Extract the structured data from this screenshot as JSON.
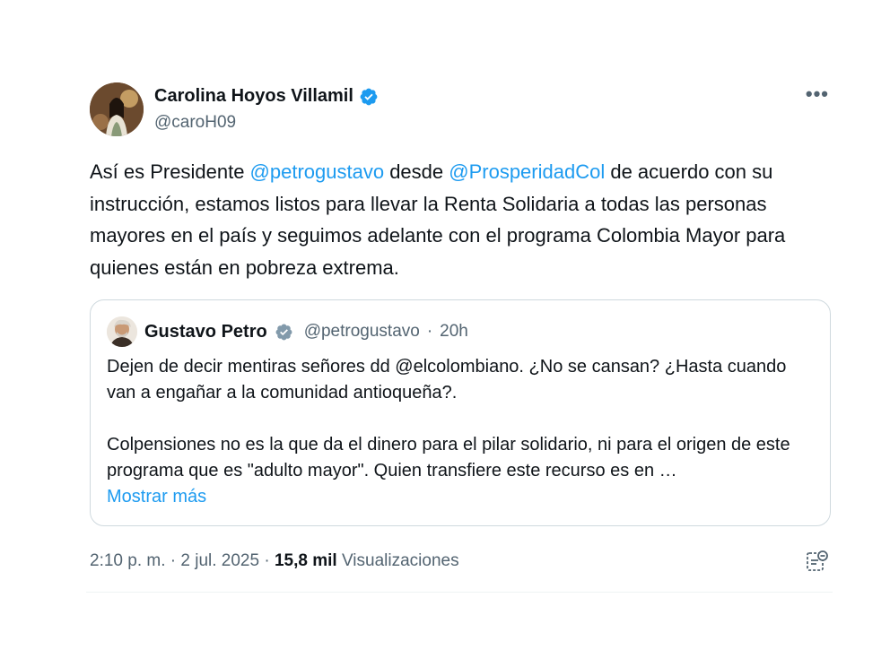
{
  "tweet": {
    "author_name": "Carolina Hoyos Villamil",
    "author_handle": "@caroH09",
    "more_label": "•••",
    "text_parts": {
      "p1": "Así  es Presidente ",
      "mention1": "@petrogustavo",
      "p2": " desde ",
      "mention2": "@ProsperidadCol",
      "p3": " de acuerdo con su instrucción, estamos listos para llevar la Renta Solidaria a todas las personas mayores en el país y seguimos adelante con el programa Colombia Mayor para quienes están en pobreza extrema."
    },
    "time": "2:10 p. m.",
    "date": "2 jul. 2025",
    "views_count": "15,8 mil",
    "views_label": "Visualizaciones",
    "separator": "·"
  },
  "quote": {
    "author_name": "Gustavo Petro",
    "author_handle": "@petrogustavo",
    "separator": "·",
    "age": "20h",
    "paragraph1": "Dejen de decir mentiras señores dd @elcolombiano. ¿No se cansan? ¿Hasta cuando van a engañar a la comunidad antioqueña?.",
    "paragraph2": "Colpensiones no es la que da el dinero para el pilar solidario, ni para el origen de este programa que es \"adulto mayor\". Quien transfiere este recurso es en …",
    "show_more": "Mostrar más"
  },
  "icons": {
    "verified": "verified-badge-icon",
    "more": "more-options-icon",
    "analytics": "post-analytics-icon"
  },
  "colors": {
    "accent": "#1d9bf0",
    "text": "#0f1419",
    "muted": "#536471",
    "border": "#cfd9de"
  }
}
